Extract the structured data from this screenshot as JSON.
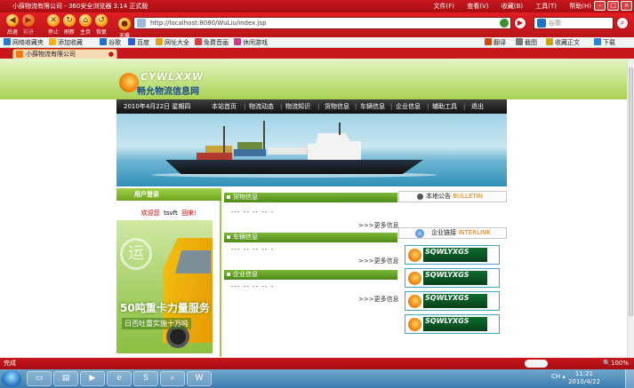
{
  "window": {
    "title": "小薛物流有限公司 - 360安全浏览器 3.14 正式版",
    "menu": [
      "文件(F)",
      "查看(V)",
      "收藏(B)",
      "工具(T)",
      "帮助(H)"
    ]
  },
  "toolbar": {
    "buttons": [
      {
        "label": "后退",
        "icon": "back-icon"
      },
      {
        "label": "前进",
        "icon": "forward-icon"
      },
      {
        "label": "停止",
        "icon": "stop-icon"
      },
      {
        "label": "刷新",
        "icon": "refresh-icon"
      },
      {
        "label": "主页",
        "icon": "home-icon"
      },
      {
        "label": "恢复",
        "icon": "restore-icon"
      },
      {
        "label": "无痕",
        "icon": "incognito-icon"
      }
    ],
    "address": "http://localhost:8080/WuLiu/index.jsp",
    "search_placeholder": "谷歌"
  },
  "favorites": {
    "items": [
      "网络收藏夹",
      "添加收藏",
      "谷歌",
      "百度",
      "网址大全",
      "免费音画",
      "休闲游戏"
    ],
    "right_items": [
      "翻译",
      "截图",
      "收藏正文",
      "下载"
    ]
  },
  "tab": {
    "label": "小薛物流有限公司"
  },
  "site": {
    "logo_en": "CYWLXXW",
    "logo_cn": "畅允物流信息网",
    "date": "2010年4月22日 星期四",
    "nav": [
      "本站首页",
      "物流动态",
      "物流知识",
      "货物信息",
      "车辆信息",
      "企业信息",
      "辅助工具",
      "退出"
    ],
    "user_header": "用户登录",
    "welcome_prefix": "欢迎您",
    "welcome_user": "tsvft",
    "welcome_suffix": "回来!",
    "promo_yun": "运",
    "promo_line1": "50吨重卡力量服务",
    "promo_line2": "日否吐重实施十万吨",
    "sections": [
      {
        "title": "货物信息",
        "dashes": "--- -- -- -- -",
        "more": ">>>更多信息"
      },
      {
        "title": "车辆信息",
        "dashes": "--- -- -- -- -",
        "more": ">>>更多信息"
      },
      {
        "title": "企业信息",
        "dashes": "--- -- -- -- -",
        "more": ">>>更多信息"
      }
    ],
    "bulletin_cn": "本地公告",
    "bulletin_en": "BULLETIN",
    "links_cn": "企业链接",
    "links_en": "INTERLINK",
    "sponsors": [
      "SQWLYXGS",
      "SQWLYXGS",
      "SQWLYXGS",
      "SQWLYXGS"
    ]
  },
  "status": {
    "text": "完成",
    "zoom": "100%"
  },
  "taskbar": {
    "time": "11:21",
    "date": "2010/4/22",
    "lang": "CH"
  }
}
